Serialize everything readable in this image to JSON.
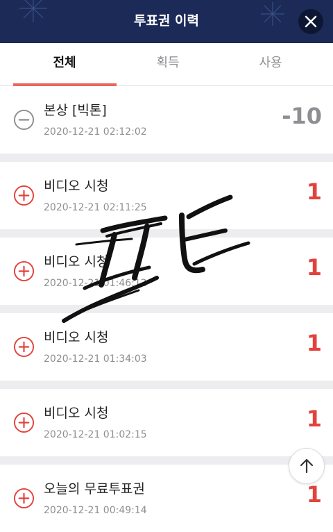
{
  "header": {
    "title": "투표권 이력"
  },
  "tabs": [
    {
      "label": "전체"
    },
    {
      "label": "획득"
    },
    {
      "label": "사용"
    }
  ],
  "active_tab": 0,
  "items": [
    {
      "name": "본상 [빅톤]",
      "date": "2020-12-21 02:12:02",
      "amount": "-10",
      "type": "minus"
    },
    {
      "name": "비디오 시청",
      "date": "2020-12-21 02:11:25",
      "amount": "1",
      "type": "plus"
    },
    {
      "name": "비디오 시청",
      "date": "2020-12-21 01:46:12",
      "amount": "1",
      "type": "plus"
    },
    {
      "name": "비디오 시청",
      "date": "2020-12-21 01:34:03",
      "amount": "1",
      "type": "plus"
    },
    {
      "name": "비디오 시청",
      "date": "2020-12-21 01:02:15",
      "amount": "1",
      "type": "plus"
    },
    {
      "name": "오늘의 무료투표권",
      "date": "2020-12-21 00:49:14",
      "amount": "1",
      "type": "plus"
    }
  ],
  "colors": {
    "header_bg": "#1b2a57",
    "accent": "#e8675f",
    "plus": "#e2423c",
    "minus": "#8e8e93"
  },
  "icons": {
    "close": "close-icon",
    "plus": "plus-circle-icon",
    "minus": "minus-circle-icon",
    "scroll_top": "arrow-up-icon"
  }
}
